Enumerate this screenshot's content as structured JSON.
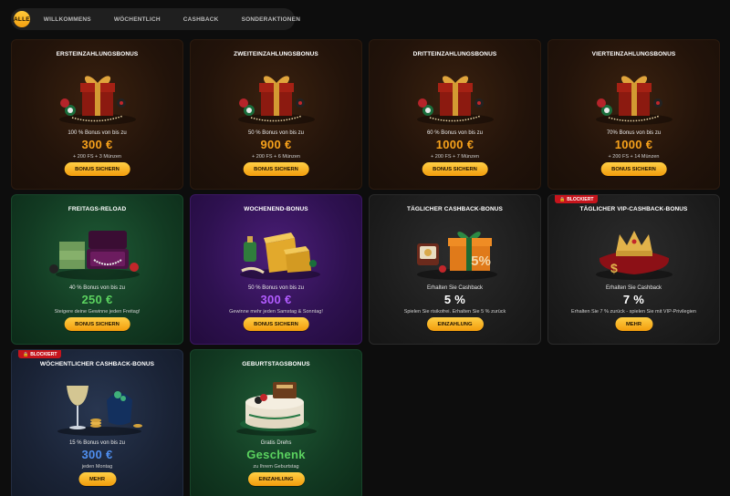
{
  "tabs": [
    {
      "label": "ALLE",
      "active": true
    },
    {
      "label": "WILLKOMMENS",
      "active": false
    },
    {
      "label": "WÖCHENTLICH",
      "active": false
    },
    {
      "label": "CASHBACK",
      "active": false
    },
    {
      "label": "SONDERAKTIONEN",
      "active": false
    }
  ],
  "cards": [
    {
      "title": "ERSTEINZAHLUNGSBONUS",
      "line1": "100 % Bonus von bis zu",
      "amount": "300 €",
      "line2": "+ 200 FS + 3 Münzen",
      "button": "BONUS SICHERN",
      "amount_color": "#f7a21b"
    },
    {
      "title": "ZWEITEINZAHLUNGSBONUS",
      "line1": "50 % Bonus von bis zu",
      "amount": "900 €",
      "line2": "+ 200 FS + 6 Münzen",
      "button": "BONUS SICHERN",
      "amount_color": "#f7a21b"
    },
    {
      "title": "DRITTEINZAHLUNGSBONUS",
      "line1": "60 % Bonus von bis zu",
      "amount": "1000 €",
      "line2": "+ 200 FS + 7 Münzen",
      "button": "BONUS SICHERN",
      "amount_color": "#f7a21b"
    },
    {
      "title": "VIERTEINZAHLUNGSBONUS",
      "line1": "70% Bonus von bis zu",
      "amount": "1000 €",
      "line2": "+ 200 FS + 14 Münzen",
      "button": "BONUS SICHERN",
      "amount_color": "#f7a21b"
    },
    {
      "title": "FREITAGS-RELOAD",
      "line1": "40 % Bonus von bis zu",
      "amount": "250 €",
      "line2": "Steigere deine Gewinne jeden Freitag!",
      "button": "BONUS SICHERN",
      "amount_color": "#5bd25f"
    },
    {
      "title": "WOCHENEND-BONUS",
      "line1": "50 % Bonus von bis zu",
      "amount": "300 €",
      "line2": "Gewinne mehr jeden Samstag & Sonntag!",
      "button": "BONUS SICHERN",
      "amount_color": "#b25cff"
    },
    {
      "title": "TÄGLICHER CASHBACK-BONUS",
      "line1": "Erhalten Sie Cashback",
      "amount": "5 %",
      "line2": "Spielen Sie risikofrei. Erhalten Sie 5 % zurück",
      "button": "EINZAHLUNG",
      "amount_color": "#ffffff"
    },
    {
      "title": "TÄGLICHER VIP-CASHBACK-BONUS",
      "line1": "Erhalten Sie Cashback",
      "amount": "7 %",
      "line2": "Erhalten Sie 7 % zurück - spielen Sie mit VIP-Privilegien",
      "button": "MEHR",
      "amount_color": "#ffffff",
      "badge": "BLOCKIERT"
    },
    {
      "title": "WÖCHENTLICHER CASHBACK-BONUS",
      "line1": "15 % Bonus von bis zu",
      "amount": "300 €",
      "line2": "jeden Montag",
      "button": "MEHR",
      "amount_color": "#4f8ff0",
      "badge": "BLOCKIERT"
    },
    {
      "title": "GEBURTSTAGSBONUS",
      "line1": "Gratis Drehs",
      "amount": "Geschenk",
      "line2": "zu Ihrem Geburtstag",
      "button": "EINZAHLUNG",
      "amount_color": "#5bd25f"
    }
  ],
  "art_labels": {
    "cashback_box": "5%"
  },
  "colors": {
    "accent": "#f7a21b",
    "blocked": "#c6141c"
  }
}
